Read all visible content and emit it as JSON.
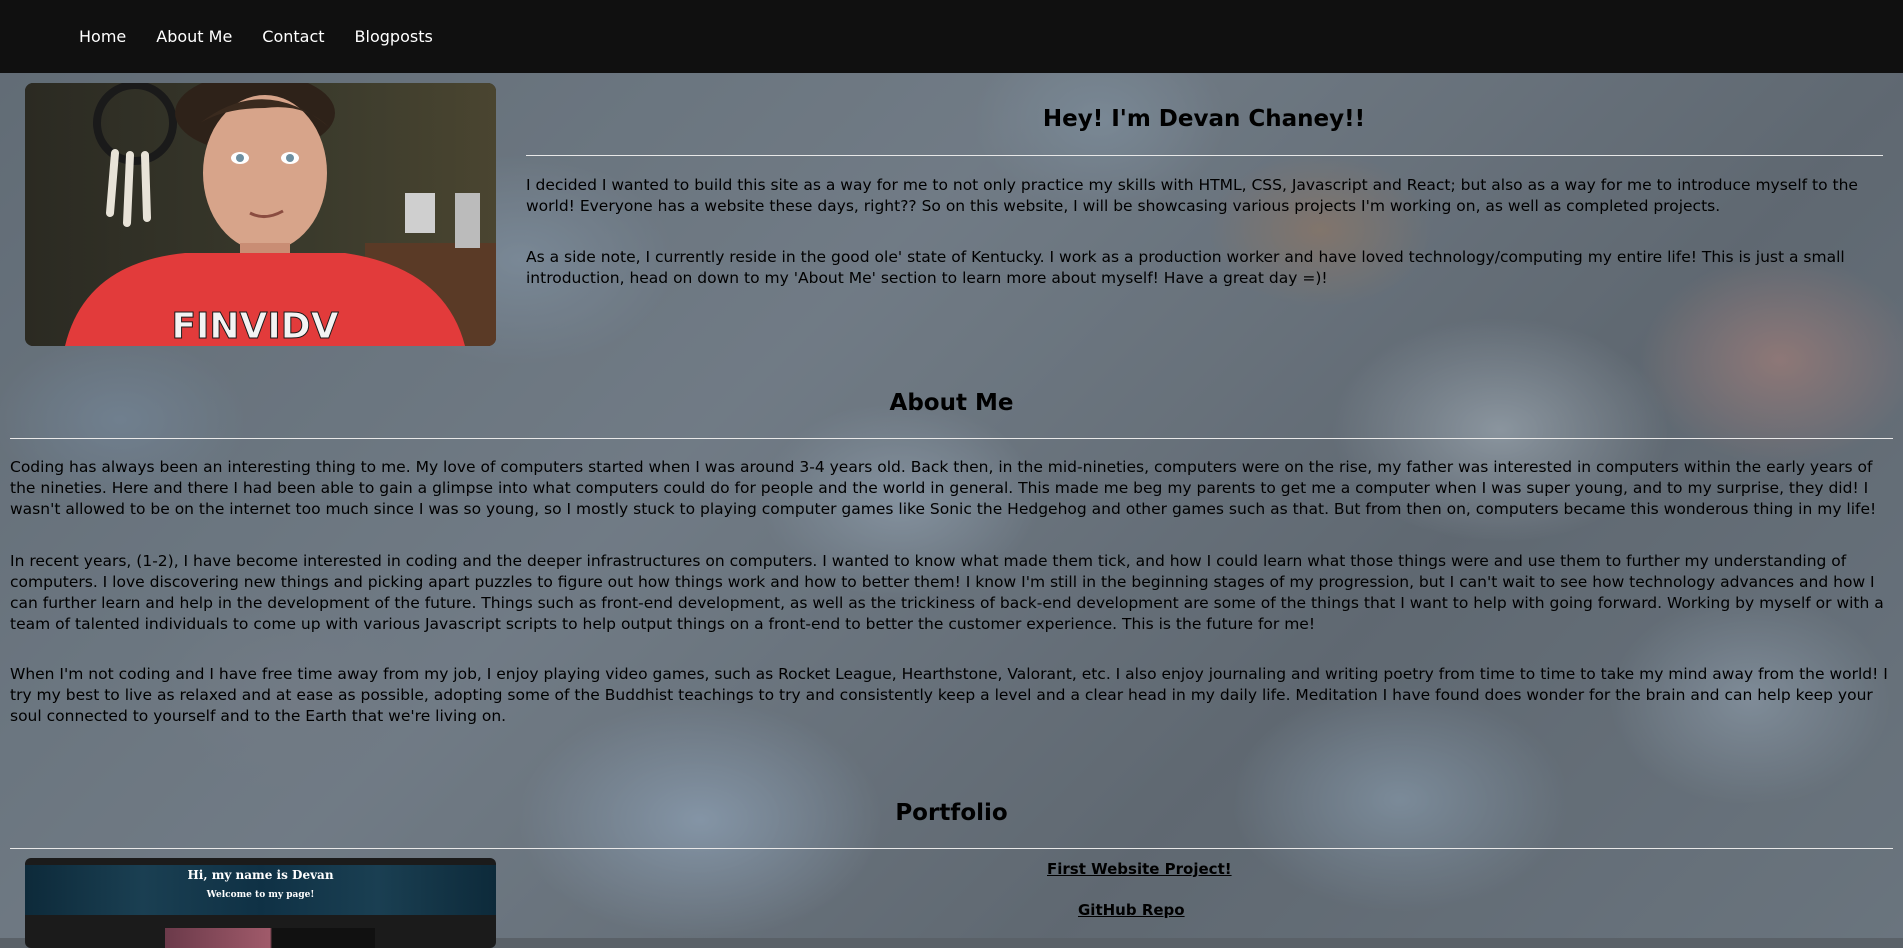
{
  "nav": {
    "items": [
      {
        "label": "Home"
      },
      {
        "label": "About Me"
      },
      {
        "label": "Contact"
      },
      {
        "label": "Blogposts"
      }
    ]
  },
  "hero": {
    "title": "Hey! I'm Devan Chaney!!",
    "paragraphs": [
      "I decided I wanted to build this site as a way for me to not only practice my skills with HTML, CSS, Javascript and React; but also as a way for me to introduce myself to the world! Everyone has a website these days, right?? So on this website, I will be showcasing various projects I'm working on, as well as completed projects.",
      "As a side note, I currently reside in the good ole' state of Kentucky. I work as a production worker and have loved technology/computing my entire life! This is just a small introduction, head on down to my 'About Me' section to learn more about myself! Have a great day =)!"
    ]
  },
  "about": {
    "title": "About Me",
    "paragraphs": [
      "Coding has always been an interesting thing to me. My love of computers started when I was around 3-4 years old. Back then, in the mid-nineties, computers were on the rise, my father was interested in computers within the early years of the nineties. Here and there I had been able to gain a glimpse into what computers could do for people and the world in general. This made me beg my parents to get me a computer when I was super young, and to my surprise, they did! I wasn't allowed to be on the internet too much since I was so young, so I mostly stuck to playing computer games like Sonic the Hedgehog and other games such as that. But from then on, computers became this wonderous thing in my life!",
      "In recent years, (1-2), I have become interested in coding and the deeper infrastructures on computers. I wanted to know what made them tick, and how I could learn what those things were and use them to further my understanding of computers. I love discovering new things and picking apart puzzles to figure out how things work and how to better them! I know I'm still in the beginning stages of my progression, but I can't wait to see how technology advances and how I can further learn and help in the development of the future. Things such as front-end development, as well as the trickiness of back-end development are some of the things that I want to help with going forward. Working by myself or with a team of talented individuals to come up with various Javascript scripts to help output things on a front-end to better the customer experience. This is the future for me!",
      "When I'm not coding and I have free time away from my job, I enjoy playing video games, such as Rocket League, Hearthstone, Valorant, etc. I also enjoy journaling and writing poetry from time to time to take my mind away from the world! I try my best to live as relaxed and at ease as possible, adopting some of the Buddhist teachings to try and consistently keep a level and a clear head in my daily life. Meditation I have found does wonder for the brain and can help keep your soul connected to yourself and to the Earth that we're living on."
    ]
  },
  "portfolio": {
    "title": "Portfolio",
    "thumbnail": {
      "title": "Hi, my name is Devan",
      "subtitle": "Welcome to my page!"
    },
    "links": [
      {
        "label": "First Website Project!"
      },
      {
        "label": "GitHub Repo"
      }
    ]
  }
}
